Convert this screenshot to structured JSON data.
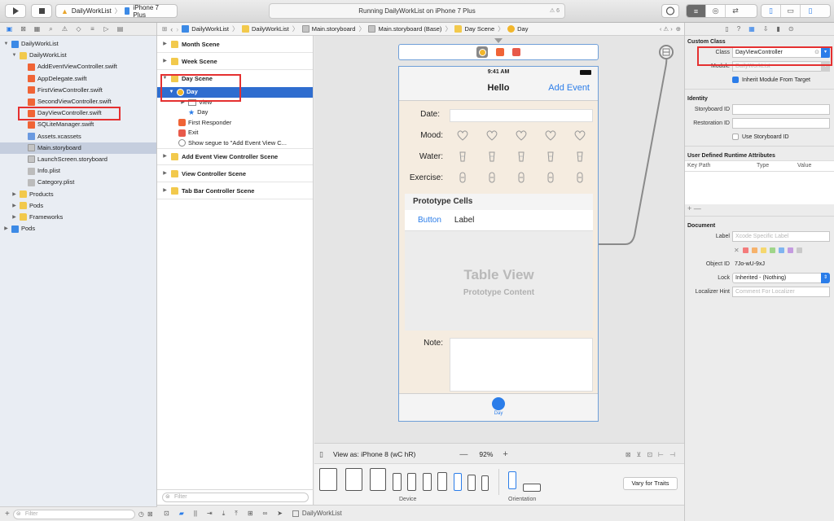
{
  "toolbar": {
    "scheme": "DailyWorkList",
    "device": "iPhone 7 Plus",
    "status": "Running DailyWorkList on iPhone 7 Plus",
    "warnings": "6"
  },
  "navigator": {
    "items": [
      {
        "label": "DailyWorkList",
        "indent": 0,
        "kind": "proj",
        "disc": "▼"
      },
      {
        "label": "DailyWorkList",
        "indent": 1,
        "kind": "fold",
        "disc": "▼"
      },
      {
        "label": "AddEventViewController.swift",
        "indent": 2,
        "kind": "swift",
        "disc": ""
      },
      {
        "label": "AppDelegate.swift",
        "indent": 2,
        "kind": "swift",
        "disc": ""
      },
      {
        "label": "FirstViewController.swift",
        "indent": 2,
        "kind": "swift",
        "disc": ""
      },
      {
        "label": "SecondViewController.swift",
        "indent": 2,
        "kind": "swift",
        "disc": ""
      },
      {
        "label": "DayViewController.swift",
        "indent": 2,
        "kind": "swift",
        "disc": ""
      },
      {
        "label": "SQLiteManager.swift",
        "indent": 2,
        "kind": "swift",
        "disc": ""
      },
      {
        "label": "Assets.xcassets",
        "indent": 2,
        "kind": "xca",
        "disc": ""
      },
      {
        "label": "Main.storyboard",
        "indent": 2,
        "kind": "sb",
        "disc": "",
        "selected": true
      },
      {
        "label": "LaunchScreen.storyboard",
        "indent": 2,
        "kind": "sb",
        "disc": ""
      },
      {
        "label": "Info.plist",
        "indent": 2,
        "kind": "plist",
        "disc": ""
      },
      {
        "label": "Category.plist",
        "indent": 2,
        "kind": "plist",
        "disc": ""
      },
      {
        "label": "Products",
        "indent": 1,
        "kind": "fold",
        "disc": "▶"
      },
      {
        "label": "Pods",
        "indent": 1,
        "kind": "fold",
        "disc": "▶"
      },
      {
        "label": "Frameworks",
        "indent": 1,
        "kind": "fold",
        "disc": "▶"
      },
      {
        "label": "Pods",
        "indent": 0,
        "kind": "proj",
        "disc": "▶"
      }
    ],
    "filter_placeholder": "Filter"
  },
  "jumpbar": {
    "crumbs": [
      "DailyWorkList",
      "DailyWorkList",
      "Main.storyboard",
      "Main.storyboard (Base)",
      "Day Scene",
      "Day"
    ]
  },
  "outline": {
    "month_scene": "Month Scene",
    "week_scene": "Week Scene",
    "day_scene": "Day Scene",
    "day": "Day",
    "view": "View",
    "day_tab": "Day",
    "first_responder": "First Responder",
    "exit": "Exit",
    "segue": "Show segue to \"Add Event View C...",
    "add_event_scene": "Add Event View Controller Scene",
    "view_controller_scene": "View Controller Scene",
    "tab_bar_scene": "Tab Bar Controller Scene",
    "filter_placeholder": "Filter"
  },
  "phone": {
    "time": "9:41 AM",
    "title": "Hello",
    "add_event": "Add Event",
    "date_label": "Date:",
    "mood_label": "Mood:",
    "water_label": "Water:",
    "exercise_label": "Exercise:",
    "prototype_cells": "Prototype Cells",
    "cell_button": "Button",
    "cell_label": "Label",
    "table_view": "Table View",
    "prototype_content": "Prototype Content",
    "note_label": "Note:",
    "tab_label": "Day"
  },
  "canvas_bottom": {
    "view_as": "View as: iPhone 8 (wC hR)",
    "zoom": "92%",
    "device_label": "Device",
    "orientation_label": "Orientation",
    "vary": "Vary for Traits"
  },
  "debugbar": {
    "target": "DailyWorkList"
  },
  "inspector": {
    "custom_class": "Custom Class",
    "class_label": "Class",
    "class_value": "DayViewController",
    "module_label": "Module",
    "module_value": "DailyWorkList",
    "inherit": "Inherit Module From Target",
    "identity": "Identity",
    "storyboard_id_label": "Storyboard ID",
    "restoration_id_label": "Restoration ID",
    "use_storyboard_id": "Use Storyboard ID",
    "udra_title": "User Defined Runtime Attributes",
    "key_path": "Key Path",
    "type": "Type",
    "value": "Value",
    "document": "Document",
    "label_label": "Label",
    "label_placeholder": "Xcode Specific Label",
    "object_id_label": "Object ID",
    "object_id": "7Jo-wU-9xJ",
    "lock_label": "Lock",
    "lock_value": "Inherited - (Nothing)",
    "localizer_label": "Localizer Hint",
    "localizer_placeholder": "Comment For Localizer"
  },
  "colors": {
    "accent": "#2b7de9",
    "highlight": "#e53030",
    "scene_bg": "#f5ece0"
  }
}
